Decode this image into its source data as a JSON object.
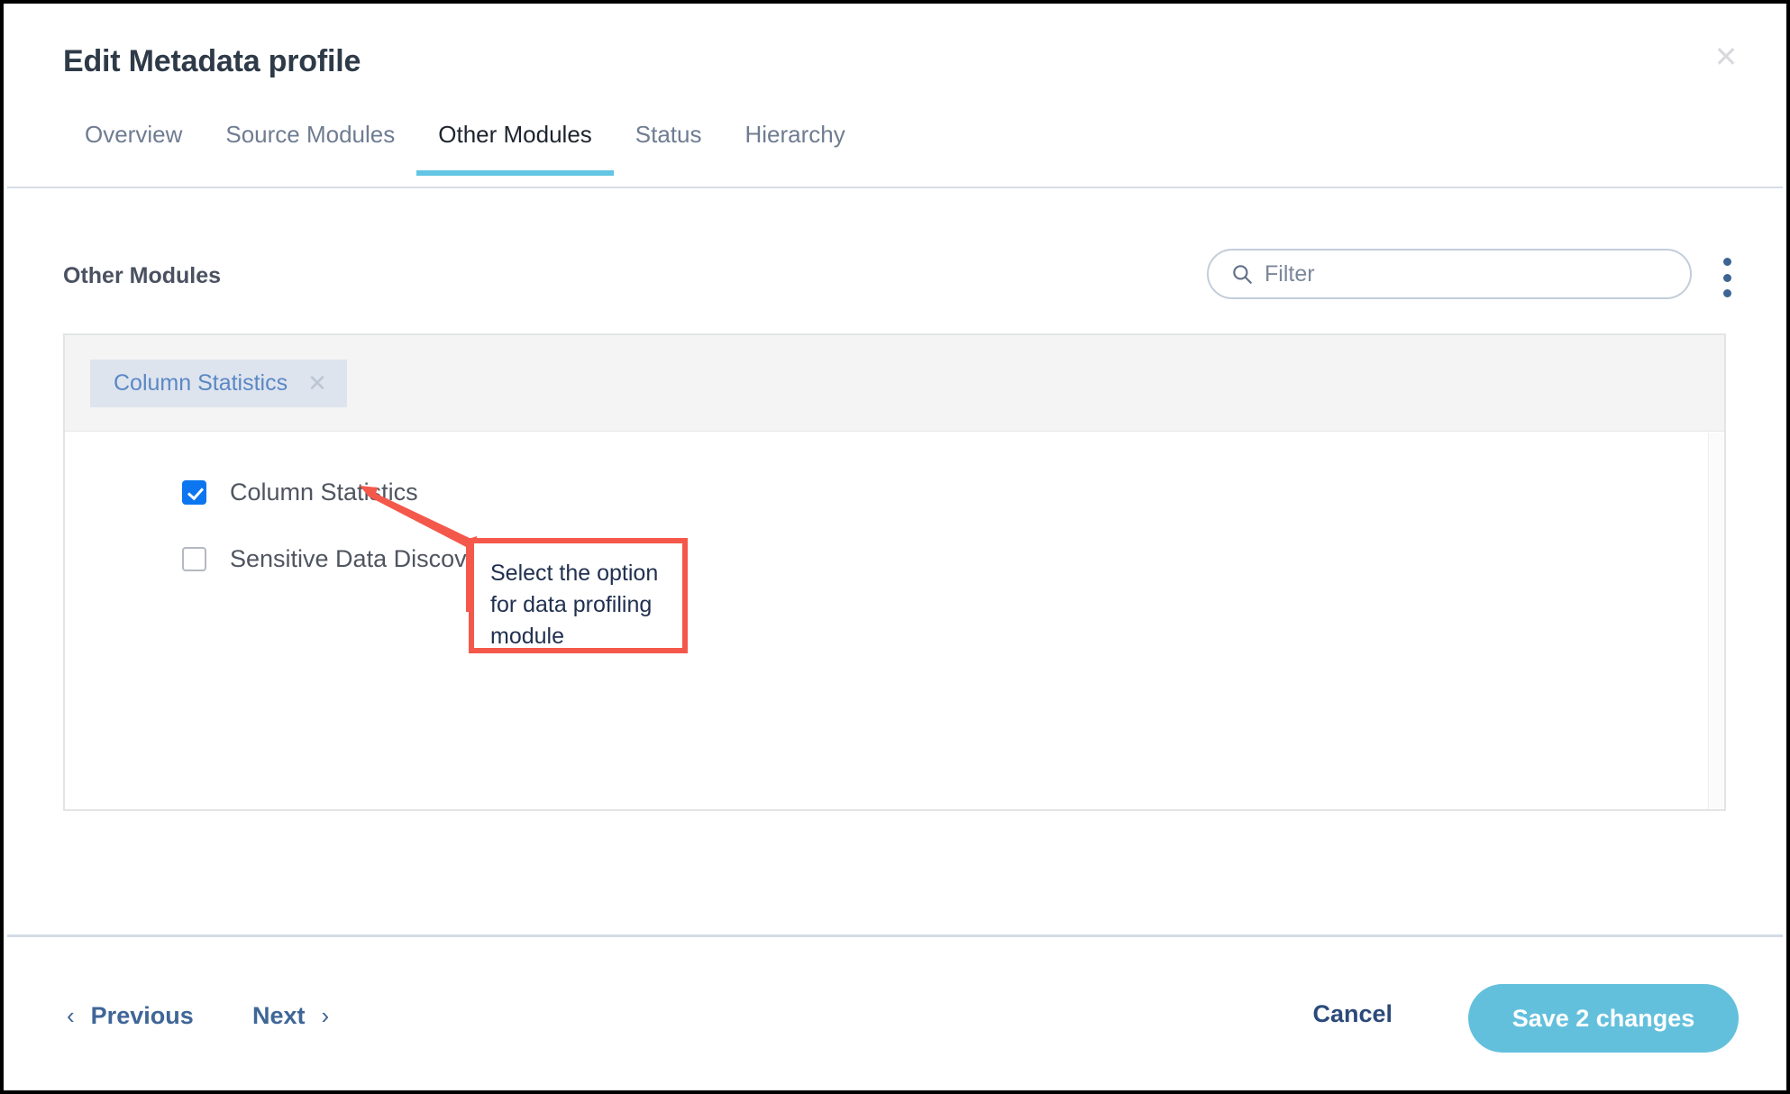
{
  "dialog": {
    "title": "Edit Metadata profile",
    "close_label": "✕"
  },
  "tabs": [
    {
      "label": "Overview",
      "active": false
    },
    {
      "label": "Source Modules",
      "active": false
    },
    {
      "label": "Other Modules",
      "active": true
    },
    {
      "label": "Status",
      "active": false
    },
    {
      "label": "Hierarchy",
      "active": false
    }
  ],
  "section": {
    "title": "Other Modules"
  },
  "filter": {
    "value": "",
    "placeholder": "Filter",
    "icon": "search-icon"
  },
  "overflow_menu": {
    "icon": "kebab-menu-icon"
  },
  "selected_chips": [
    {
      "label": "Column Statistics",
      "remove_label": "✕"
    }
  ],
  "options": [
    {
      "label": "Column Statistics",
      "checked": true
    },
    {
      "label": "Sensitive Data Discovery",
      "checked": false
    }
  ],
  "annotation": {
    "text": "Select the option\nfor data profiling\nmodule",
    "color": "#f4584b"
  },
  "footer": {
    "previous_label": "Previous",
    "previous_chevron": "‹",
    "next_label": "Next",
    "next_chevron": "›",
    "cancel_label": "Cancel",
    "save_label": "Save 2 changes"
  },
  "colors": {
    "accent": "#63c5e3",
    "checkbox_checked": "#0b76ef",
    "chip_bg": "#dde4ee",
    "chip_text": "#5b87c4",
    "link_blue": "#3f6697",
    "annotation_red": "#f4584b"
  }
}
